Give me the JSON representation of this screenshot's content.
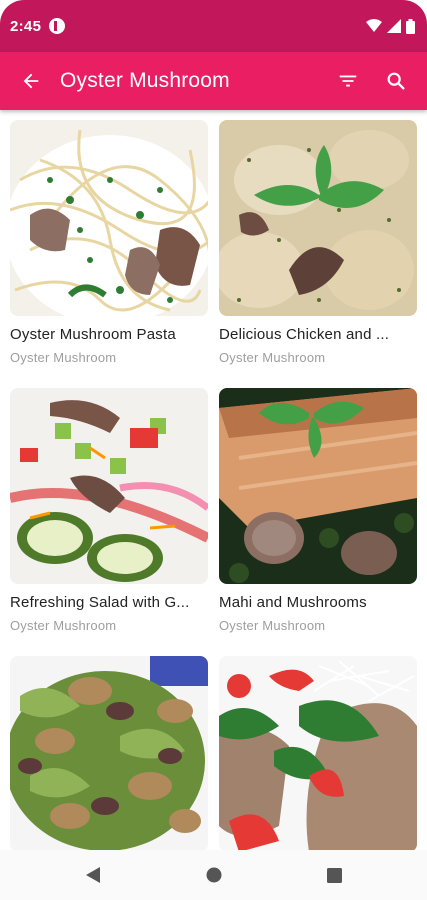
{
  "status_bar": {
    "time": "2:45"
  },
  "app_bar": {
    "title": "Oyster Mushroom"
  },
  "recipes": [
    {
      "title": "Oyster Mushroom Pasta",
      "category": "Oyster Mushroom"
    },
    {
      "title": "Delicious Chicken and ...",
      "category": "Oyster Mushroom"
    },
    {
      "title": "Refreshing Salad with G...",
      "category": "Oyster Mushroom"
    },
    {
      "title": "Mahi and Mushrooms",
      "category": "Oyster Mushroom"
    },
    {
      "title": "",
      "category": ""
    },
    {
      "title": "",
      "category": ""
    }
  ],
  "icons": {
    "back": "arrow-back-icon",
    "filter": "filter-icon",
    "search": "search-icon",
    "nav_back": "nav-back-icon",
    "nav_home": "nav-home-icon",
    "nav_recents": "nav-recents-icon"
  },
  "colors": {
    "status_bar": "#c2185b",
    "app_bar": "#e91e63",
    "title_text": "#222222",
    "category_text": "#9e9e9e"
  }
}
